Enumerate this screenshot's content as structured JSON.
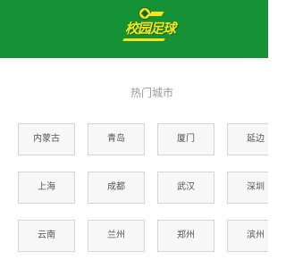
{
  "header": {
    "logo_text": "校园足球",
    "brand_color": "#159136",
    "accent_color": "#f7e31b"
  },
  "hot_cities": {
    "title": "热门城市",
    "cities": [
      "内蒙古",
      "青岛",
      "厦门",
      "延边",
      "上海",
      "成都",
      "武汉",
      "深圳",
      "云南",
      "兰州",
      "郑州",
      "滨州"
    ]
  }
}
